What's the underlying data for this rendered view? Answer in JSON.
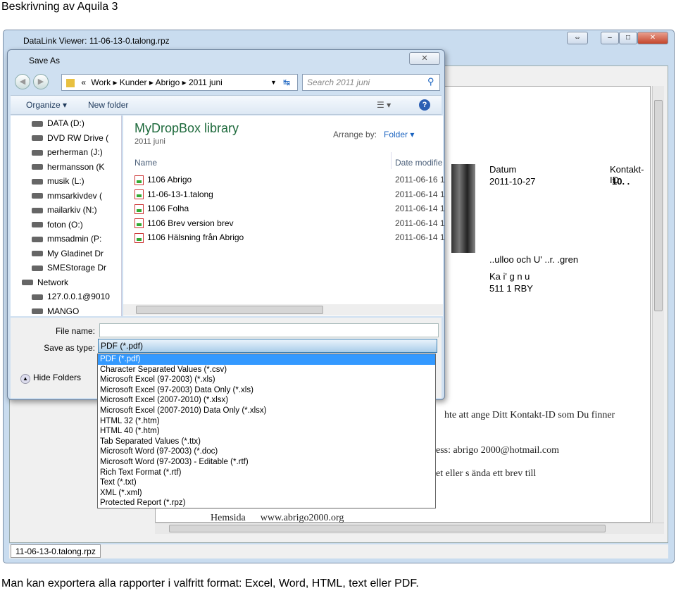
{
  "page": {
    "heading": "Beskrivning av Aquila 3",
    "caption": "Man kan exportera alla rapporter i valfritt format: Excel, Word, HTML, text eller PDF."
  },
  "viewer": {
    "title": "DataLink Viewer:  11-06-13-0.talong.rpz",
    "status_tab": "11-06-13-0.talong.rpz",
    "doc": {
      "datum_label": "Datum",
      "datum": "2011-10-27",
      "kontakt_label": "Kontakt-ID",
      "kontakt": "10. .",
      "name": "..ulloo och U' ..r. .gren",
      "addr1": "Ka  i'   g  n  u",
      "addr2": "511   1    RBY",
      "line1": "hte att ange Ditt Kontakt-ID som Du finner",
      "line2": "ess: abrigo 2000@hotmail.com",
      "line3": "et eller s ända ett brev till",
      "line4": "Hemsida      www.abrigo2000.org"
    }
  },
  "dialog": {
    "title": "Save As",
    "close": "✕",
    "breadcrumb": [
      "«",
      "Work",
      "Kunder",
      "Abrigo",
      "2011 juni"
    ],
    "search_placeholder": "Search 2011 juni",
    "toolbar": {
      "organize": "Organize ▾",
      "new_folder": "New folder"
    },
    "nav": [
      "DATA (D:)",
      "DVD RW Drive (",
      "perherman (J:)",
      "hermansson (K",
      "musik (L:)",
      "mmsarkivdev (",
      "mailarkiv (N:)",
      "foton (O:)",
      "mmsadmin (P:",
      "My Gladinet Dr",
      "SMEStorage Dr",
      "Network",
      "127.0.0.1@9010",
      "MANGO"
    ],
    "library_title": "MyDropBox library",
    "library_sub": "2011 juni",
    "arrange_label": "Arrange by:",
    "arrange_value": "Folder ▾",
    "columns": {
      "name": "Name",
      "date": "Date modifie"
    },
    "files": [
      {
        "name": "1106 Abrigo",
        "date": "2011-06-16 1"
      },
      {
        "name": "11-06-13-1.talong",
        "date": "2011-06-14 1"
      },
      {
        "name": "1106 Folha",
        "date": "2011-06-14 1"
      },
      {
        "name": "1106  Brev version brev",
        "date": "2011-06-14 1"
      },
      {
        "name": "1106 Hälsning från Abrigo",
        "date": "2011-06-14 1"
      }
    ],
    "file_name_label": "File name:",
    "file_name": "",
    "save_type_label": "Save as type:",
    "save_type": "PDF (*.pdf)",
    "hide_folders": "Hide Folders",
    "type_options": [
      "PDF (*.pdf)",
      "Character Separated Values (*.csv)",
      "Microsoft Excel (97-2003) (*.xls)",
      "Microsoft Excel (97-2003) Data Only (*.xls)",
      "Microsoft Excel (2007-2010) (*.xlsx)",
      "Microsoft Excel (2007-2010) Data Only (*.xlsx)",
      "HTML 32 (*.htm)",
      "HTML 40 (*.htm)",
      "Tab Separated Values (*.ttx)",
      "Microsoft Word (97-2003) (*.doc)",
      "Microsoft Word (97-2003) - Editable (*.rtf)",
      "Rich Text Format (*.rtf)",
      "Text (*.txt)",
      "XML (*.xml)",
      "Protected Report (*.rpz)"
    ],
    "selected_option": 0
  }
}
